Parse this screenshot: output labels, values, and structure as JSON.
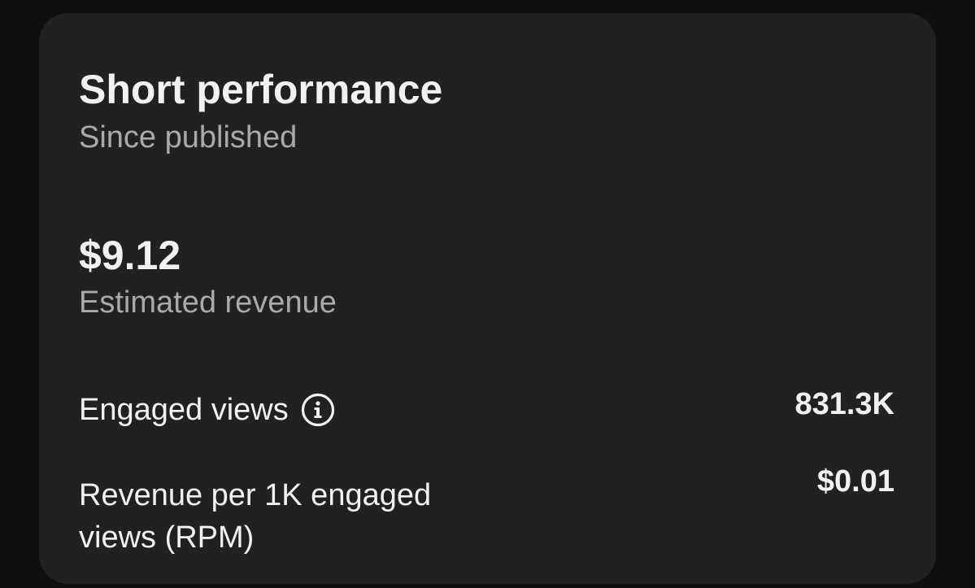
{
  "card": {
    "title": "Short performance",
    "subtitle": "Since published"
  },
  "revenue": {
    "value": "$9.12",
    "label": "Estimated revenue"
  },
  "metrics": [
    {
      "label": "Engaged views",
      "value": "831.3K",
      "icon": "info-icon"
    },
    {
      "label": "Revenue per 1K engaged views (RPM)",
      "value": "$0.01"
    }
  ],
  "colors": {
    "background": "#0f0f0f",
    "card": "#212121",
    "primary_text": "#f1f1f1",
    "secondary_text": "#aaaaaa"
  }
}
